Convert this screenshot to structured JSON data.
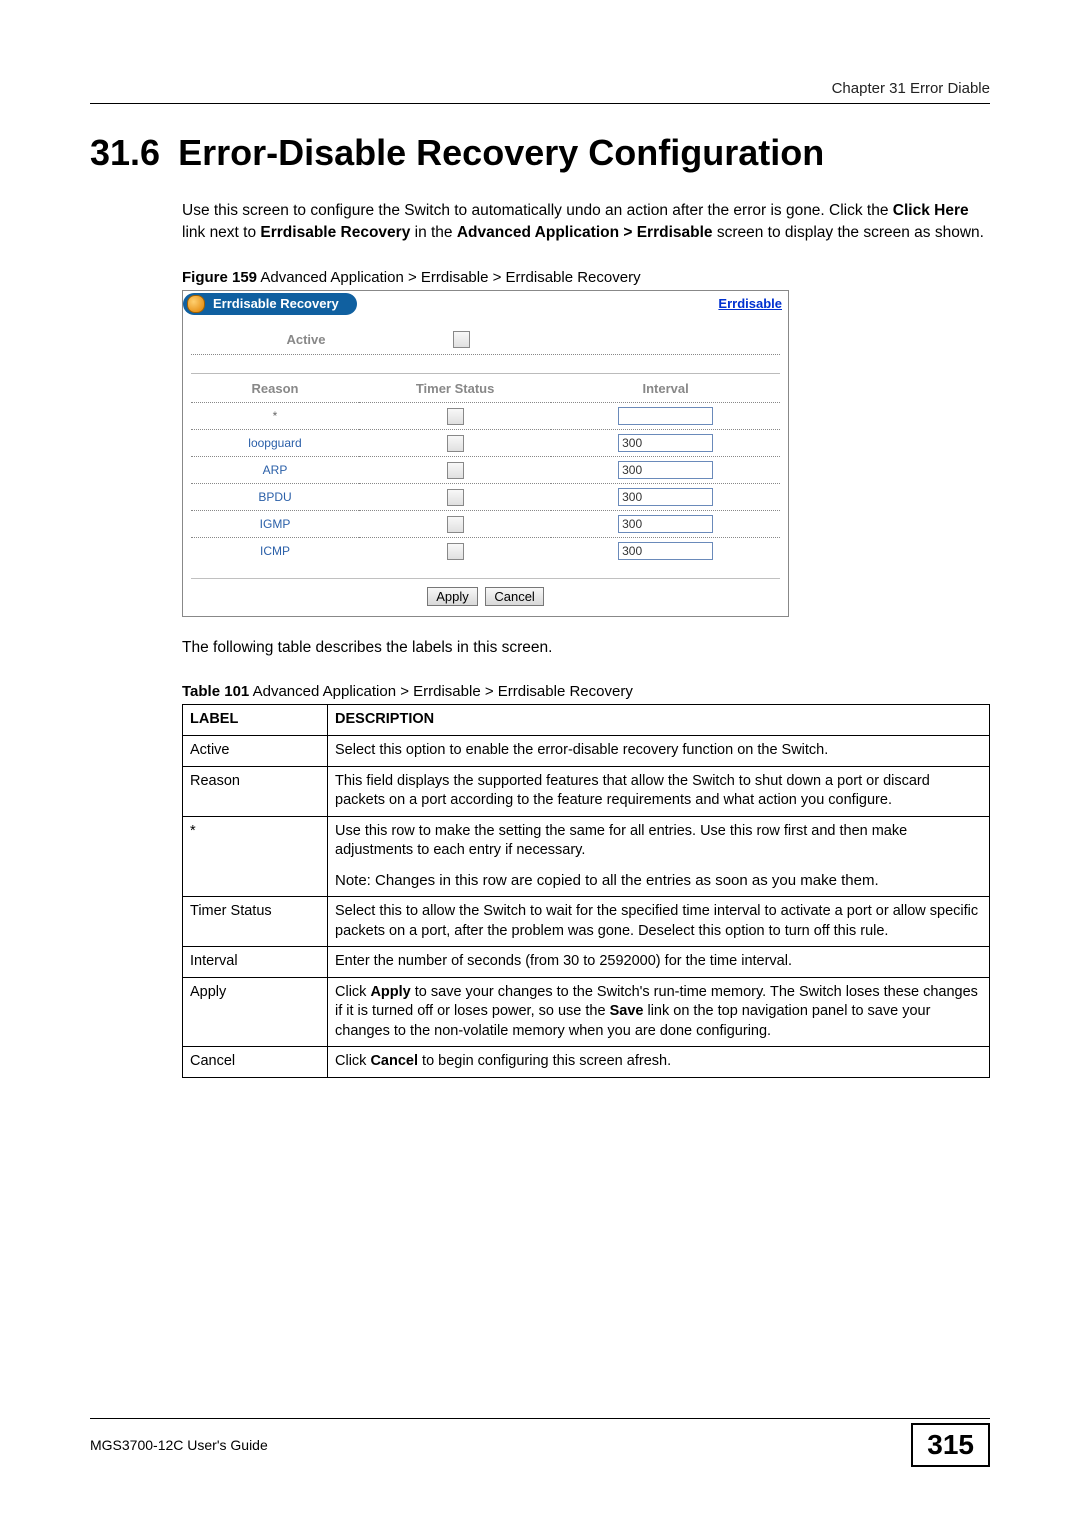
{
  "chapter_header": "Chapter 31 Error Diable",
  "heading_number": "31.6",
  "heading_title": "Error-Disable Recovery Configuration",
  "intro_para_html": "Use this screen to configure  the Switch to automatically undo an action after the error is gone. Click the <b>Click Here</b> link next to <b>Errdisable Recovery</b> in the <b>Advanced Application > Errdisable</b> screen to display the screen as shown.",
  "figure_caption_bold": "Figure 159",
  "figure_caption_rest": "   Advanced Application > Errdisable > Errdisable Recovery",
  "ui": {
    "title": "Errdisable Recovery",
    "link": "Errdisable",
    "active_label": "Active",
    "cols": {
      "reason": "Reason",
      "timer": "Timer Status",
      "interval": "Interval"
    },
    "rows": [
      {
        "reason": "*",
        "interval": ""
      },
      {
        "reason": "loopguard",
        "interval": "300"
      },
      {
        "reason": "ARP",
        "interval": "300"
      },
      {
        "reason": "BPDU",
        "interval": "300"
      },
      {
        "reason": "IGMP",
        "interval": "300"
      },
      {
        "reason": "ICMP",
        "interval": "300"
      }
    ],
    "apply": "Apply",
    "cancel": "Cancel"
  },
  "mid_para": "The following table describes the labels in this screen.",
  "table_caption_bold": "Table 101",
  "table_caption_rest": "   Advanced Application > Errdisable > Errdisable Recovery",
  "desc_headers": {
    "label": "LABEL",
    "description": "DESCRIPTION"
  },
  "desc_rows": [
    {
      "label": "Active",
      "desc_html": "Select this option to enable the error-disable recovery function on the Switch."
    },
    {
      "label": "Reason",
      "desc_html": "This field displays the supported features that allow the Switch to shut down a port or discard packets on a port according to the feature requirements and what action you configure."
    },
    {
      "label": "*",
      "desc_html": "Use this row to make the setting the same for all entries. Use this row first and then make adjustments to each entry if necessary.<div class=\"note-para\">Note: Changes in this row are copied to all the entries as soon as you make them.</div>"
    },
    {
      "label": "Timer Status",
      "desc_html": "Select this to allow the Switch to wait for the specified time interval to activate a port or allow specific packets on a port, after the problem was gone. Deselect this option to turn off this rule."
    },
    {
      "label": "Interval",
      "desc_html": "Enter the number of seconds (from 30 to 2592000) for the time interval."
    },
    {
      "label": "Apply",
      "desc_html": "Click <b>Apply</b> to save your changes to the Switch's run-time memory. The Switch loses these changes if it is turned off or loses power, so use the <b>Save</b> link on the top navigation panel to save your changes to the non-volatile memory when you are done configuring."
    },
    {
      "label": "Cancel",
      "desc_html": "Click <b>Cancel</b> to begin configuring this screen afresh."
    }
  ],
  "footer_guide": "MGS3700-12C User's Guide",
  "page_number": "315"
}
